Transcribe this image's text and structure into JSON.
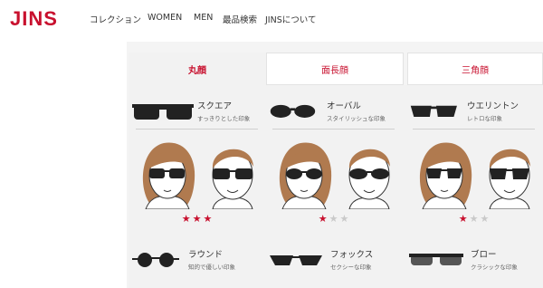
{
  "header": {
    "logo": "JINS",
    "nav": [
      "コレクション",
      "WOMEN",
      "MEN",
      "最品検索",
      "JINSについて"
    ]
  },
  "tabs": [
    "丸顔",
    "面長顔",
    "三角顔"
  ],
  "shapes_top": [
    {
      "name": "スクエア",
      "desc": "すっきりとした印象",
      "rating": 3
    },
    {
      "name": "オーバル",
      "desc": "スタイリッシュな印象",
      "rating": 1
    },
    {
      "name": "ウエリントン",
      "desc": "レトロな印象",
      "rating": 1
    }
  ],
  "shapes_bottom": [
    {
      "name": "ラウンド",
      "desc": "知的で優しい印象"
    },
    {
      "name": "フォックス",
      "desc": "セクシーな印象"
    },
    {
      "name": "ブロー",
      "desc": "クラシックな印象"
    }
  ],
  "colors": {
    "brand": "#c8102e",
    "star_off": "#c9c9c9"
  }
}
